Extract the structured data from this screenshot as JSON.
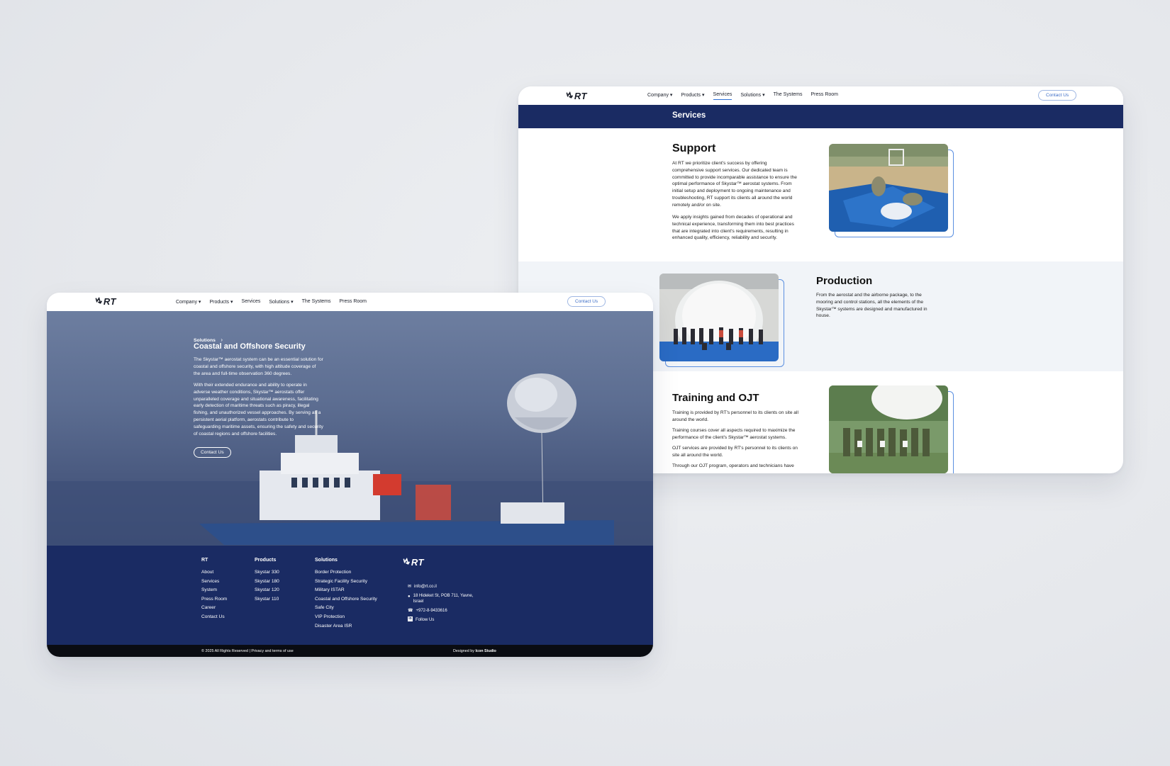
{
  "brand": {
    "logo_text": "RT"
  },
  "nav": {
    "items": [
      "Company",
      "Products",
      "Services",
      "Solutions",
      "The Systems",
      "Press Room"
    ],
    "contact": "Contact Us"
  },
  "services_page": {
    "banner_title": "Services",
    "support": {
      "title": "Support",
      "p1_lines": [
        "At RT we prioritize client's success by offering",
        "comprehensive support services. Our dedicated team is",
        "committed to provide incomparable assistance to ensure the",
        "optimal performance of Skystar™ aerostat systems. From",
        "initial setup and deployment to ongoing maintenance and",
        "troubleshooting, RT support its clients all around the world",
        "remotely and/or on site."
      ],
      "p2_lines": [
        "We apply insights gained from decades of operational and",
        "technical experience, transforming them into best practices",
        "that are integrated into client's requirements, resulting in",
        "enhanced quality, efficiency, reliability and security."
      ]
    },
    "production": {
      "title": "Production",
      "p_lines": [
        "From the aerostat and the airborne package, to the",
        "mooring and control stations, all the elements of the",
        "Skystar™ systems are designed and manufactured in",
        "house."
      ]
    },
    "training": {
      "title": "Training and OJT",
      "p1_lines": [
        "Training is provided by RT's personnel to its clients on site all",
        "around the world."
      ],
      "p2_lines": [
        "Training courses cover all aspects required to maximize the",
        "performance of the client's Skystar™ aerostat systems."
      ],
      "p3_lines": [
        "OJT services are provided by RT's personnel to its clients on",
        "site all around the world."
      ],
      "p4_lines": [
        "Through our OJT program, operators and technicians have"
      ]
    }
  },
  "solution_page": {
    "breadcrumb": "Solutions",
    "breadcrumb_sep": "›",
    "title": "Coastal and Offshore Security",
    "p1_lines": [
      "The Skystar™ aerostat system can be an essential solution for",
      "coastal and offshore security, with high altitude coverage of",
      "the area and full-time observation 360 degrees."
    ],
    "p2_lines": [
      "With their extended endurance and ability to operate in",
      "adverse weather conditions, Skystar™ aerostats offer",
      "unparalleled coverage and situational awareness, facilitating",
      "early detection of maritime threats such as piracy, illegal",
      "fishing, and unauthorized vessel approaches. By serving as a",
      "persistent aerial platform, aerostats contribute to",
      "safeguarding maritime assets, ensuring the safety and security",
      "of coastal regions and offshore facilities."
    ],
    "cta": "Contact Us"
  },
  "footer": {
    "rt": {
      "title": "RT",
      "items": [
        "About",
        "Services",
        "System",
        "Press Room",
        "Career",
        "Contact Us"
      ]
    },
    "products": {
      "title": "Products",
      "items": [
        "Skystar 330",
        "Skystar 180",
        "Skystar 120",
        "Skystar 110"
      ]
    },
    "solutions": {
      "title": "Solutions",
      "items": [
        "Border Protection",
        "Strategic Facility Security",
        "Military ISTAR",
        "Coastal and Offshore Security",
        "Safe City",
        "VIP Protection",
        "Disaster Area ISR"
      ]
    },
    "contact": {
      "email": "info@rt.co.il",
      "address_lines": [
        "18 Hideket St, POB 711, Yavne,",
        "Israel"
      ],
      "phone": "+972-8-9433616",
      "follow": "Follow Us"
    },
    "copyright": "© 2025 All Rights Reserved | Privacy and terms of use",
    "designed_prefix": "Designed by",
    "designed_by": "Icon Studio"
  },
  "colors": {
    "navy": "#1a2b63",
    "accent": "#2b6fd6"
  }
}
